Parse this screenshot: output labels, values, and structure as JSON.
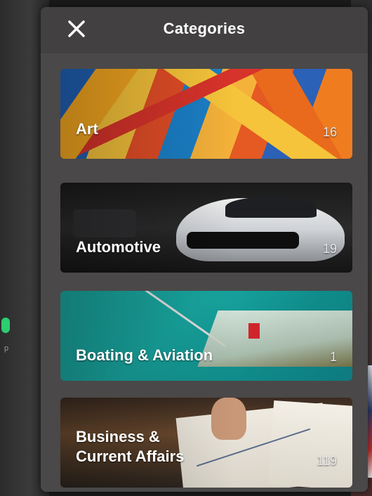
{
  "header": {
    "title": "Categories",
    "close_icon": "close-icon"
  },
  "categories": [
    {
      "label": "Art",
      "count": "16"
    },
    {
      "label": "Automotive",
      "count": "19"
    },
    {
      "label": "Boating & Aviation",
      "count": "1"
    },
    {
      "label_line1": "Business  &",
      "label_line2": "Current Affairs",
      "count": "119"
    }
  ],
  "background": {
    "left_text": "p"
  },
  "colors": {
    "panel": "#4a4848",
    "header": "#424040",
    "text": "#ffffff"
  }
}
